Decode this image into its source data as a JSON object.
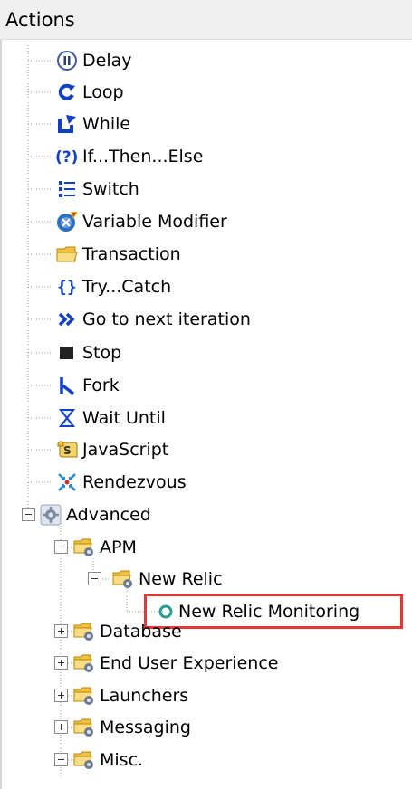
{
  "panel": {
    "title": "Actions"
  },
  "tree": {
    "actions": [
      {
        "label": "Delay",
        "icon": "pause-circle-icon"
      },
      {
        "label": "Loop",
        "icon": "loop-arrow-icon"
      },
      {
        "label": "While",
        "icon": "while-arrow-icon"
      },
      {
        "label": "If...Then...Else",
        "icon": "question-icon"
      },
      {
        "label": "Switch",
        "icon": "switch-list-icon"
      },
      {
        "label": "Variable Modifier",
        "icon": "variable-modifier-icon"
      },
      {
        "label": "Transaction",
        "icon": "folder-icon"
      },
      {
        "label": "Try...Catch",
        "icon": "braces-icon"
      },
      {
        "label": "Go to next iteration",
        "icon": "double-chevron-right-icon"
      },
      {
        "label": "Stop",
        "icon": "stop-square-icon"
      },
      {
        "label": "Fork",
        "icon": "fork-icon"
      },
      {
        "label": "Wait Until",
        "icon": "hourglass-icon"
      },
      {
        "label": "JavaScript",
        "icon": "javascript-script-icon"
      },
      {
        "label": "Rendezvous",
        "icon": "rendezvous-icon"
      }
    ],
    "advanced": {
      "label": "Advanced",
      "icon": "advanced-gear-icon",
      "apm": {
        "label": "APM",
        "new_relic": {
          "label": "New Relic",
          "monitoring": {
            "label": "New Relic Monitoring",
            "icon": "monitoring-circle-icon"
          }
        }
      },
      "folders": [
        {
          "label": "Database"
        },
        {
          "label": "End User Experience"
        },
        {
          "label": "Launchers"
        },
        {
          "label": "Messaging"
        },
        {
          "label": "Misc."
        }
      ]
    }
  },
  "colors": {
    "accent_blue": "#1040c8",
    "folder_yellow": "#f5d36b",
    "highlight_red": "#e53935",
    "teal": "#2a9d8f"
  }
}
